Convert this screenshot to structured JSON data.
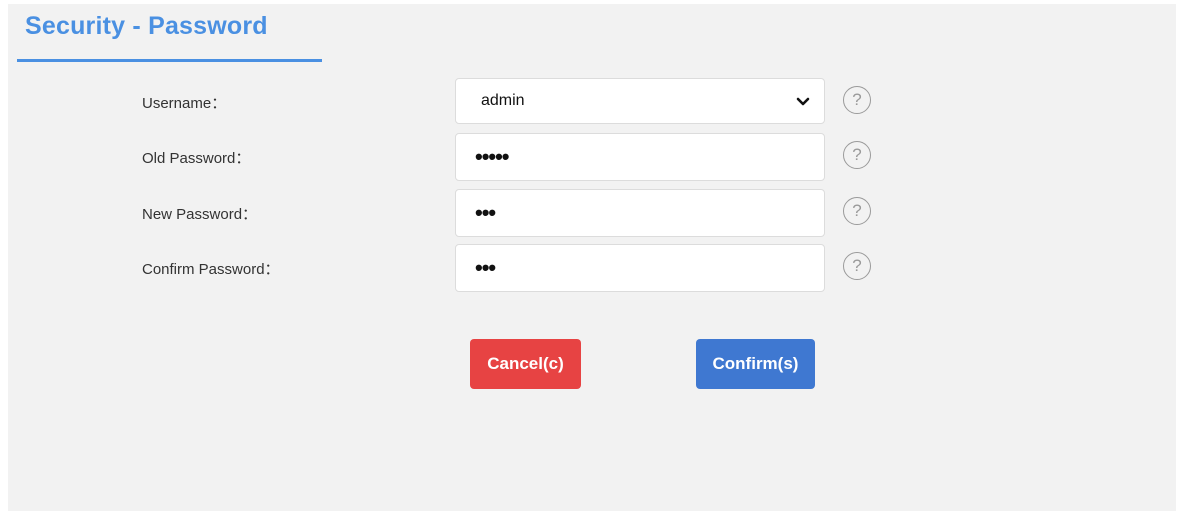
{
  "header": {
    "title": "Security - Password"
  },
  "form": {
    "fields": [
      {
        "label": "Username：",
        "value": "admin",
        "type": "select"
      },
      {
        "label": "Old Password：",
        "value": "•••••",
        "type": "password"
      },
      {
        "label": "New Password：",
        "value": "•••",
        "type": "password"
      },
      {
        "label": "Confirm Password：",
        "value": "•••",
        "type": "password"
      }
    ],
    "help_symbol": "?"
  },
  "buttons": {
    "cancel_label": "Cancel(c)",
    "confirm_label": "Confirm(s)"
  },
  "colors": {
    "accent": "#4a90e2",
    "cancel": "#e74343",
    "confirm": "#3f78d1",
    "panel_background": "#f2f2f2"
  },
  "icons": {
    "select_arrow": "chevron-down-icon",
    "help": "help-icon"
  }
}
